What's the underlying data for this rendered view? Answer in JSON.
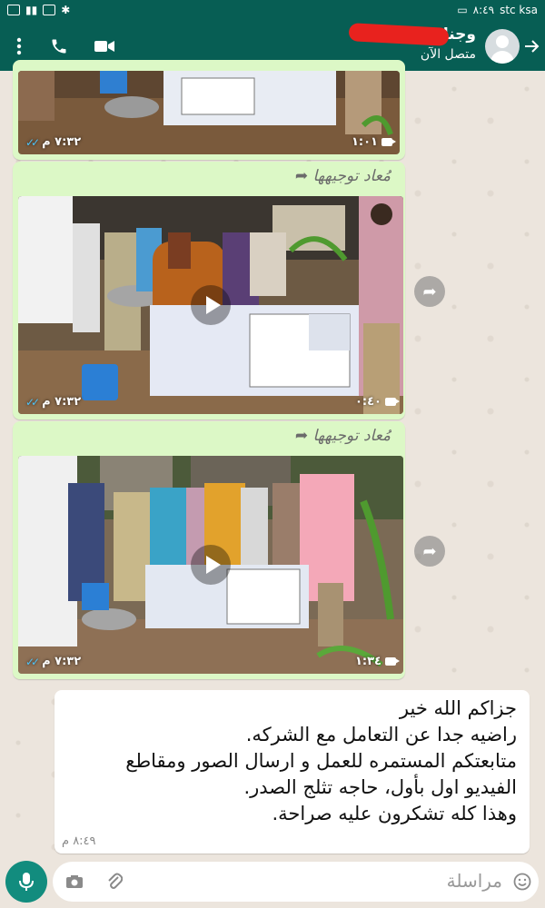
{
  "statusbar": {
    "time": "٨:٤٩",
    "carrier": "stc ksa"
  },
  "header": {
    "contact_name": "وجنا",
    "contact_status": "متصل الآن",
    "colors": {
      "bar": "#075e54"
    }
  },
  "messages": [
    {
      "type": "video",
      "forwarded_label": "",
      "duration": "١:٠١",
      "time": "٧:٣٢ م"
    },
    {
      "type": "video",
      "forwarded_label": "مُعاد توجيهها",
      "duration": "٠:٤٠",
      "time": "٧:٣٢ م"
    },
    {
      "type": "video",
      "forwarded_label": "مُعاد توجيهها",
      "duration": "١:٣٤",
      "time": "٧:٣٢ م"
    }
  ],
  "text_message": {
    "lines": [
      "جزاكم الله خير",
      "راضيه جدا عن التعامل مع الشركه.",
      "متابعتكم المستمره للعمل و ارسال الصور ومقاطع",
      "الفيديو اول بأول، حاجه تثلج الصدر.",
      "وهذا كله تشكرون عليه صراحة."
    ],
    "time": "٨:٤٩ م"
  },
  "composer": {
    "placeholder": "مراسلة"
  }
}
